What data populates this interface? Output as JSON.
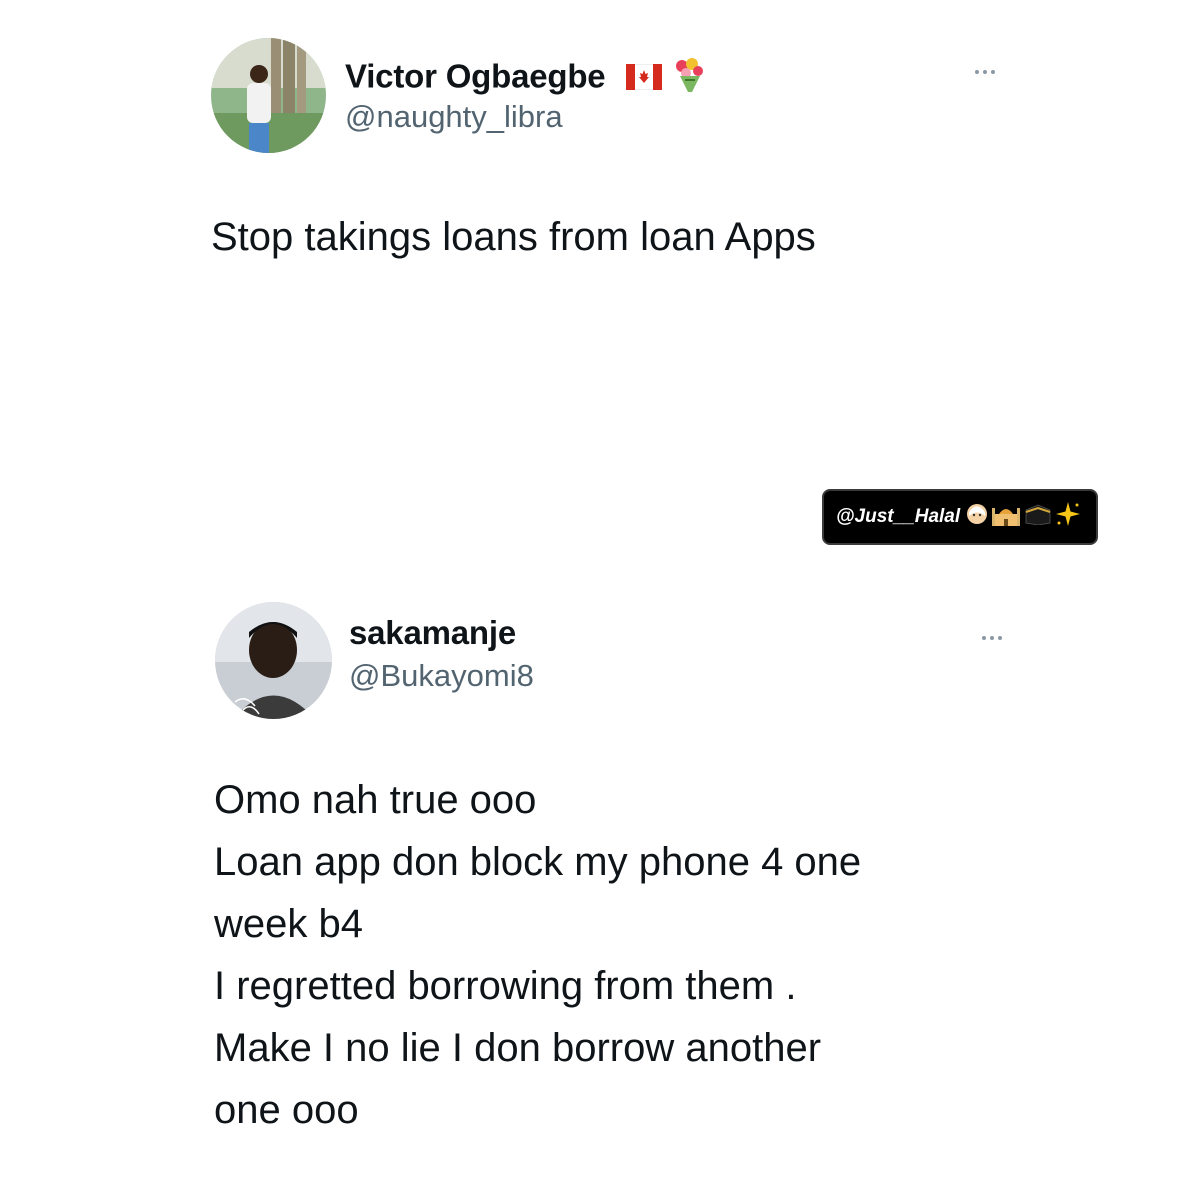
{
  "tweets": [
    {
      "display_name": "Victor Ogbaegbe",
      "handle": "@naughty_libra",
      "name_badges": [
        "canada-flag-icon",
        "bouquet-icon"
      ],
      "text_lines": [
        "Stop takings loans from loan Apps"
      ]
    },
    {
      "display_name": "sakamanje",
      "handle": "@Bukayomi8",
      "text_lines": [
        "Omo nah true ooo",
        "Loan app don block my phone 4 one",
        "week b4",
        "I regretted borrowing from them .",
        "Make I no lie I don borrow another",
        "one ooo"
      ]
    }
  ],
  "watermark": {
    "text": "@Just__Halal",
    "icons": [
      "person-icon",
      "mosque-icon",
      "kaaba-icon",
      "sparkle-icon"
    ]
  },
  "colors": {
    "text_primary": "#0f1419",
    "text_secondary": "#536471",
    "background": "#ffffff",
    "watermark_bg": "#000000"
  }
}
